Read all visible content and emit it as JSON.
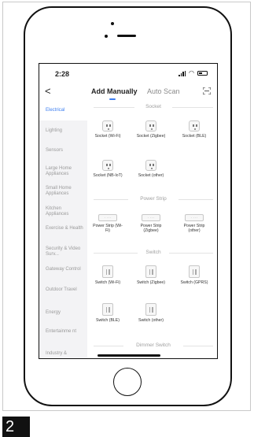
{
  "status_bar": {
    "time": "2:28"
  },
  "nav": {
    "back_glyph": "<",
    "tabs": [
      {
        "label": "Add Manually",
        "active": true
      },
      {
        "label": "Auto Scan",
        "active": false
      }
    ]
  },
  "sidebar": {
    "categories": [
      {
        "label": "Electrical",
        "active": true
      },
      {
        "label": "Lighting"
      },
      {
        "label": "Sensors"
      },
      {
        "label": "Large Home Appliances"
      },
      {
        "label": "Small Home Appliances"
      },
      {
        "label": "Kitchen Appliances"
      },
      {
        "label": "Exercise & Health"
      },
      {
        "label": "Security & Video Surv..."
      },
      {
        "label": "Gateway Control"
      },
      {
        "label": "Outdoor Travel"
      },
      {
        "label": "Energy"
      },
      {
        "label": "Entertainme nt"
      },
      {
        "label": "Industry &"
      }
    ]
  },
  "sections": {
    "socket": {
      "title": "Socket",
      "items": [
        "Socket (Wi-Fi)",
        "Socket (Zigbee)",
        "Socket (BLE)",
        "Socket (NB-IoT)",
        "Socket (other)"
      ]
    },
    "power_strip": {
      "title": "Power Strip",
      "items": [
        "Power Strip (Wi-Fi)",
        "Power Strip (Zigbee)",
        "Power Strip (other)"
      ]
    },
    "switch": {
      "title": "Switch",
      "items": [
        "Switch (Wi-Fi)",
        "Switch (Zigbee)",
        "Switch (GPRS)",
        "Switch (BLE)",
        "Switch (other)"
      ]
    },
    "dimmer_switch": {
      "title": "Dimmer Switch"
    }
  },
  "step_badge": "2",
  "colors": {
    "accent": "#3b7df0",
    "sidebar_bg": "#f3f3f5"
  },
  "icons": [
    "back-chevron-icon",
    "scan-frame-icon",
    "signal-icon",
    "wifi-icon",
    "battery-icon",
    "socket-icon",
    "power-strip-icon",
    "switch-icon"
  ]
}
